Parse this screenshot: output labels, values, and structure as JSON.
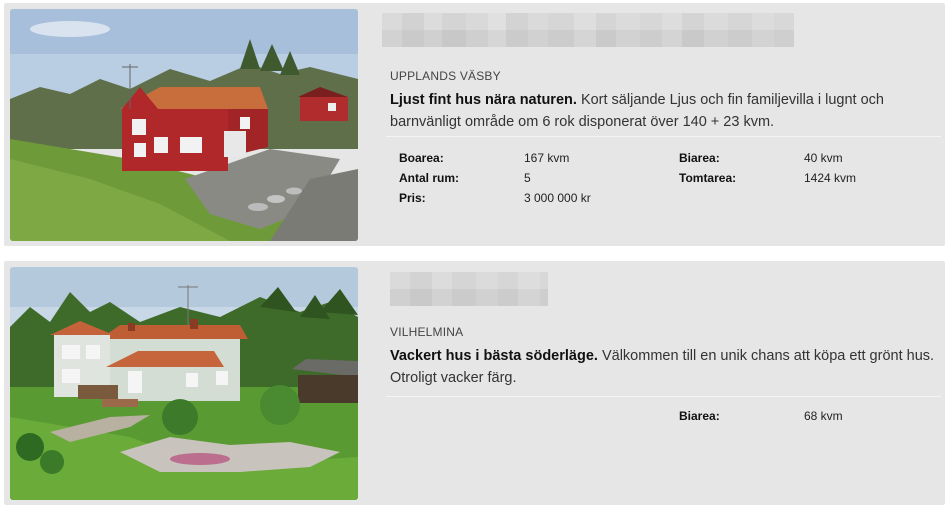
{
  "listings": [
    {
      "municipality": "UPPLANDS VÄSBY",
      "headline": "Ljust fint hus nära naturen.",
      "description": "Kort säljande Ljus och fin familjevilla i lugnt och barnvänligt område om 6 rok disponerat över 140 + 23 kvm.",
      "photo_icon": "house-photo-red-villa",
      "facts": {
        "boarea_label": "Boarea:",
        "boarea_value": "167 kvm",
        "biarea_label": "Biarea:",
        "biarea_value": "40 kvm",
        "rum_label": "Antal rum:",
        "rum_value": "5",
        "tomt_label": "Tomtarea:",
        "tomt_value": "1424 kvm",
        "pris_label": "Pris:",
        "pris_value": "3 000 000 kr"
      }
    },
    {
      "municipality": "VILHELMINA",
      "headline": "Vackert hus i bästa söderläge.",
      "description": "Välkommen till en unik chans att köpa ett grönt hus. Otroligt vacker färg.",
      "photo_icon": "house-photo-green-villa",
      "facts": {
        "biarea_label": "Biarea:",
        "biarea_value": "68 kvm"
      }
    }
  ],
  "colors": {
    "card_bg": "#e6e6e6",
    "blur_light": "#dcdcdc",
    "blur_dark": "#c8c8c8"
  }
}
